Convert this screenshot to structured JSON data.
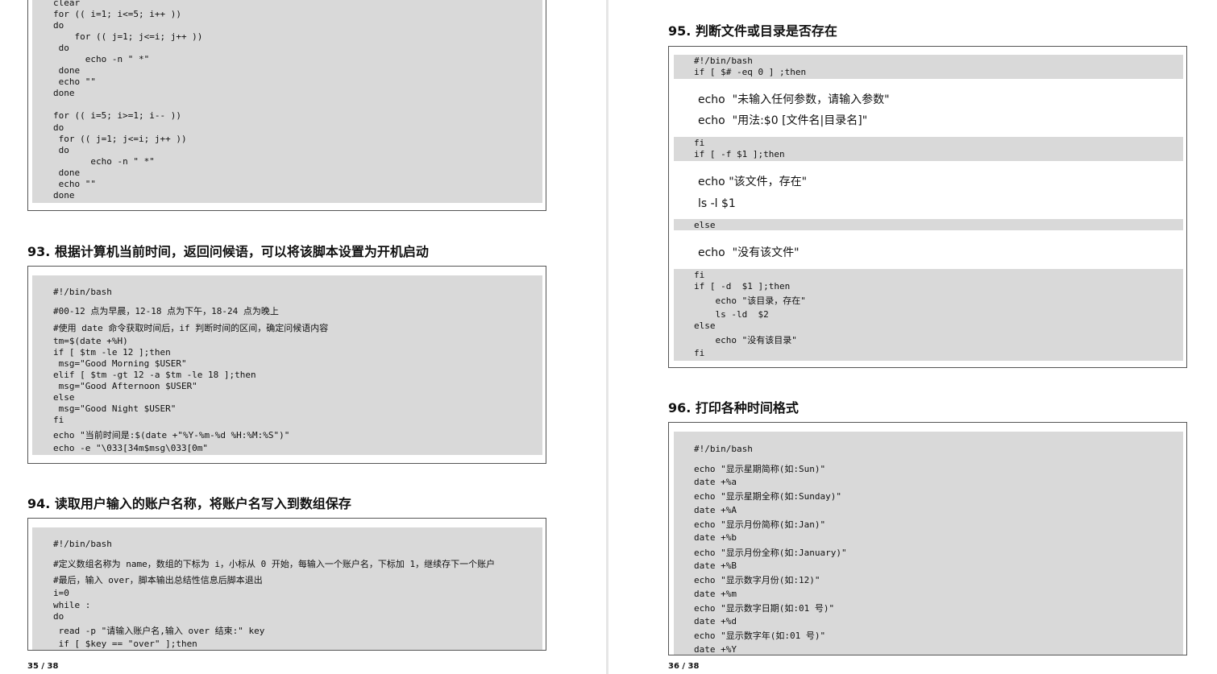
{
  "left_page": {
    "top_code": [
      "clear",
      "for (( i=1; i<=5; i++ ))",
      "do",
      "    for (( j=1; j<=i; j++ ))",
      " do",
      "      echo -n \" *\"",
      " done",
      " echo \"\"",
      "done",
      "",
      "for (( i=5; i>=1; i-- ))",
      "do",
      " for (( j=1; j<=i; j++ ))",
      " do",
      "       echo -n \" *\"",
      " done",
      " echo \"\"",
      "done"
    ],
    "section93": {
      "title": "93. 根据计算机当前时间，返回问候语，可以将该脚本设置为开机启动",
      "code": [
        "#!/bin/bash",
        "#00-12 点为早晨，12-18 点为下午，18-24 点为晚上",
        "#使用 date 命令获取时间后，if 判断时间的区间，确定问候语内容",
        "tm=$(date +%H)",
        "if [ $tm -le 12 ];then",
        " msg=\"Good Morning $USER\"",
        "elif [ $tm -gt 12 -a $tm -le 18 ];then",
        " msg=\"Good Afternoon $USER\"",
        "else",
        " msg=\"Good Night $USER\"",
        "fi",
        "echo \"当前时间是:$(date +\"%Y-%m-%d %H:%M:%S\")\"",
        "echo -e \"\\033[34m$msg\\033[0m\""
      ]
    },
    "section94": {
      "title": "94. 读取用户输入的账户名称，将账户名写入到数组保存",
      "code": [
        "#!/bin/bash",
        "#定义数组名称为 name，数组的下标为 i，小标从 0 开始，每输入一个账户名，下标加 1，继续存下一个账户",
        "#最后，输入 over，脚本输出总结性信息后脚本退出",
        "i=0",
        "while :",
        "do",
        " read -p \"请输入账户名,输入 over 结束:\" key",
        " if [ $key == \"over\" ];then"
      ]
    },
    "page_number": "35 / 38"
  },
  "right_page": {
    "section95": {
      "title": "95. 判断文件或目录是否存在",
      "code": [
        "#!/bin/bash",
        "if [ $# -eq 0 ] ;then",
        "echo  \"未输入任何参数，请输入参数\"",
        "echo  \"用法:$0 [文件名|目录名]\"",
        "fi",
        "if [ -f $1 ];then",
        "echo \"该文件，存在\"",
        "ls -l $1",
        "else",
        "echo  \"没有该文件\"",
        "fi",
        "if [ -d  $1 ];then",
        "    echo \"该目录，存在\"",
        "    ls -ld  $2",
        "else",
        "    echo \"没有该目录\"",
        "fi"
      ]
    },
    "section96": {
      "title": "96. 打印各种时间格式",
      "code": [
        "#!/bin/bash",
        "echo \"显示星期简称(如:Sun)\"",
        "date +%a",
        "echo \"显示星期全称(如:Sunday)\"",
        "date +%A",
        "echo \"显示月份简称(如:Jan)\"",
        "date +%b",
        "echo \"显示月份全称(如:January)\"",
        "date +%B",
        "echo \"显示数字月份(如:12)\"",
        "date +%m",
        "echo \"显示数字日期(如:01 号)\"",
        "date +%d",
        "echo \"显示数字年(如:01 号)\"",
        "date +%Y"
      ]
    },
    "page_number": "36 / 38"
  }
}
